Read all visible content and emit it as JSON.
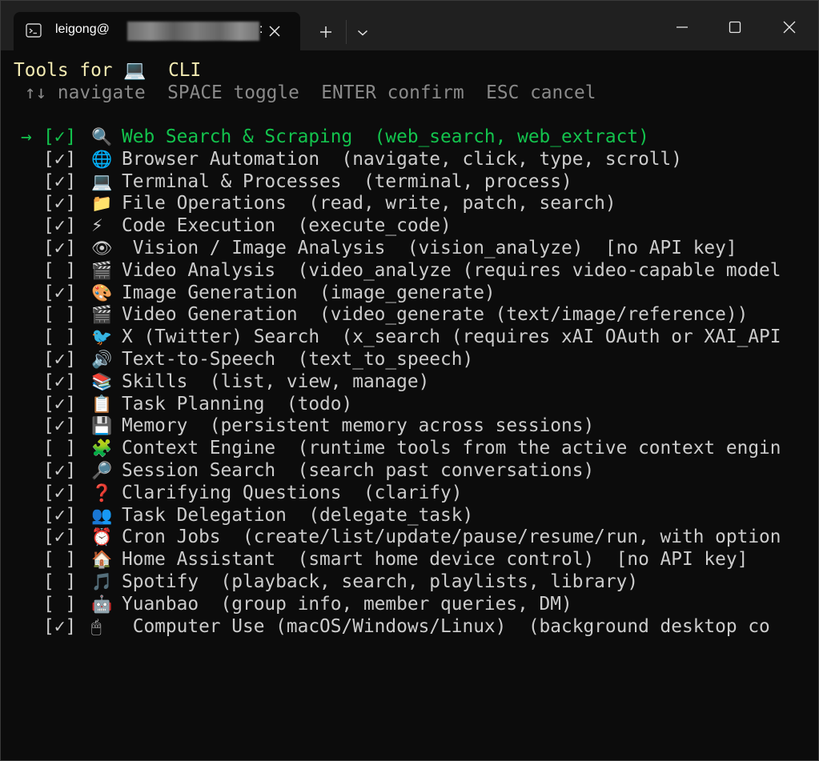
{
  "window": {
    "tab_title": "leigong@",
    "tab_title_suffix": ":",
    "tab_icon": "terminal-icon",
    "close_tab_icon": "close-icon",
    "new_tab_icon": "plus-icon",
    "dropdown_icon": "chevron-down-icon",
    "controls": [
      "minimize-icon",
      "maximize-icon",
      "close-window-icon"
    ]
  },
  "terminal": {
    "title": "Tools for 💻  CLI",
    "hint": " ↑↓ navigate  SPACE toggle  ENTER confirm  ESC cancel",
    "cursor": "→",
    "colors": {
      "background": "#0c0c0c",
      "selected": "#13c34d",
      "title": "#f2eab2",
      "hint": "#8a8a8a",
      "text": "#cccccc"
    },
    "tools": [
      {
        "checkbox": "[✓]",
        "emoji": "🔍",
        "text": "Web Search & Scraping  (web_search, web_extract)",
        "checked": true,
        "selected": true
      },
      {
        "checkbox": "[✓]",
        "emoji": "🌐",
        "text": "Browser Automation  (navigate, click, type, scroll)",
        "checked": true
      },
      {
        "checkbox": "[✓]",
        "emoji": "💻",
        "text": "Terminal & Processes  (terminal, process)",
        "checked": true
      },
      {
        "checkbox": "[✓]",
        "emoji": "📁",
        "text": "File Operations  (read, write, patch, search)",
        "checked": true
      },
      {
        "checkbox": "[✓]",
        "emoji": "⚡",
        "text": "Code Execution  (execute_code)",
        "checked": true
      },
      {
        "checkbox": "[✓]",
        "emoji": "👁",
        "text": " Vision / Image Analysis  (vision_analyze)  [no API key]",
        "checked": true
      },
      {
        "checkbox": "[ ]",
        "emoji": "🎬",
        "text": "Video Analysis  (video_analyze (requires video-capable model",
        "checked": false
      },
      {
        "checkbox": "[✓]",
        "emoji": "🎨",
        "text": "Image Generation  (image_generate)",
        "checked": true
      },
      {
        "checkbox": "[ ]",
        "emoji": "🎬",
        "text": "Video Generation  (video_generate (text/image/reference))",
        "checked": false
      },
      {
        "checkbox": "[ ]",
        "emoji": "🐦",
        "text": "X (Twitter) Search  (x_search (requires xAI OAuth or XAI_API",
        "checked": false
      },
      {
        "checkbox": "[✓]",
        "emoji": "🔊",
        "text": "Text-to-Speech  (text_to_speech)",
        "checked": true
      },
      {
        "checkbox": "[✓]",
        "emoji": "📚",
        "text": "Skills  (list, view, manage)",
        "checked": true
      },
      {
        "checkbox": "[✓]",
        "emoji": "📋",
        "text": "Task Planning  (todo)",
        "checked": true
      },
      {
        "checkbox": "[✓]",
        "emoji": "💾",
        "text": "Memory  (persistent memory across sessions)",
        "checked": true
      },
      {
        "checkbox": "[ ]",
        "emoji": "🧩",
        "text": "Context Engine  (runtime tools from the active context engin",
        "checked": false
      },
      {
        "checkbox": "[✓]",
        "emoji": "🔎",
        "text": "Session Search  (search past conversations)",
        "checked": true
      },
      {
        "checkbox": "[✓]",
        "emoji": "❓",
        "text": "Clarifying Questions  (clarify)",
        "checked": true
      },
      {
        "checkbox": "[✓]",
        "emoji": "👥",
        "text": "Task Delegation  (delegate_task)",
        "checked": true
      },
      {
        "checkbox": "[✓]",
        "emoji": "⏰",
        "text": "Cron Jobs  (create/list/update/pause/resume/run, with option",
        "checked": true
      },
      {
        "checkbox": "[ ]",
        "emoji": "🏠",
        "text": "Home Assistant  (smart home device control)  [no API key]",
        "checked": false
      },
      {
        "checkbox": "[ ]",
        "emoji": "🎵",
        "text": "Spotify  (playback, search, playlists, library)",
        "checked": false
      },
      {
        "checkbox": "[ ]",
        "emoji": "🤖",
        "text": "Yuanbao  (group info, member queries, DM)",
        "checked": false
      },
      {
        "checkbox": "[✓]",
        "emoji": "🖱",
        "text": " Computer Use (macOS/Windows/Linux)  (background desktop co",
        "checked": true
      }
    ]
  }
}
